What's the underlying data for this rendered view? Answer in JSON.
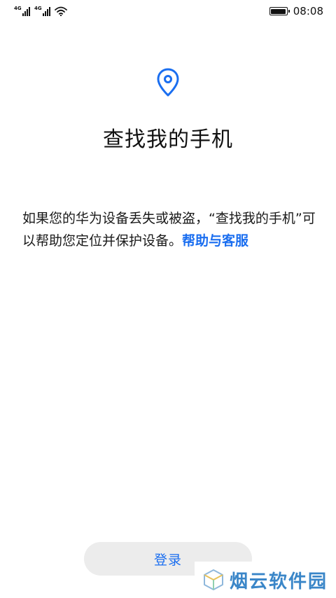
{
  "status_bar": {
    "signal_1_label": "4G",
    "signal_2_label": "4G",
    "time": "08:08",
    "battery_level": 1.0,
    "icons": [
      "signal-icon",
      "signal-icon",
      "wifi-icon",
      "battery-icon"
    ]
  },
  "main": {
    "icon": "location-pin-icon",
    "title": "查找我的手机",
    "description": "如果您的华为设备丢失或被盗，“查找我的手机”可以帮助您定位并保护设备。",
    "help_link": "帮助与客服"
  },
  "footer": {
    "login_label": "登录"
  },
  "watermark": {
    "text": "烟云软件园",
    "icon": "watermark-cube-icon"
  },
  "colors": {
    "accent": "#1a6ef0",
    "button_bg": "#ececec",
    "watermark": "#3a86c8"
  }
}
